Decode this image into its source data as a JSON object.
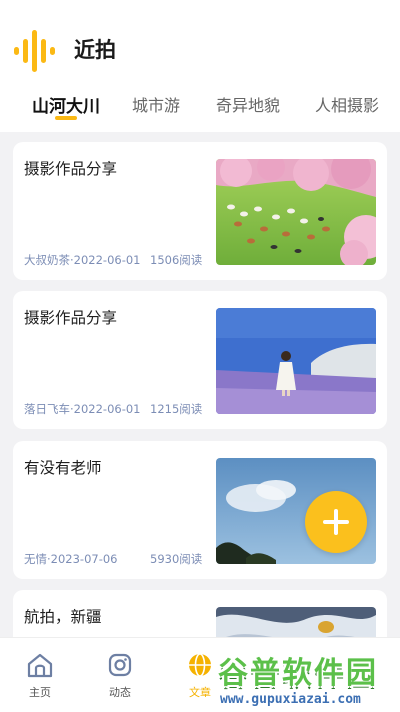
{
  "app": {
    "title": "近拍",
    "logo_icon": "sound-wave-logo-icon",
    "accent": "#fbb914"
  },
  "tabs": [
    {
      "label": "山河大川",
      "active": true
    },
    {
      "label": "城市游",
      "active": false
    },
    {
      "label": "奇异地貌",
      "active": false
    },
    {
      "label": "人相摄影",
      "active": false
    }
  ],
  "posts": [
    {
      "title": "摄影作品分享",
      "meta": "大叔奶茶·2022-06-01",
      "reads": "1506阅读",
      "image": "pink-trees-goats-meadow-photo"
    },
    {
      "title": "摄影作品分享",
      "meta": "落日飞车·2022-06-01",
      "reads": "1215阅读",
      "image": "girl-lavender-lake-photo"
    },
    {
      "title": "有没有老师",
      "meta": "无情·2023-07-06",
      "reads": "5930阅读",
      "image": "blue-sky-clouds-photo"
    },
    {
      "title": "航拍，新疆",
      "meta": "",
      "reads": "",
      "image": "aerial-snow-landscape-photo"
    }
  ],
  "fab": {
    "icon": "plus-icon"
  },
  "bottom_nav": [
    {
      "label": "主页",
      "icon": "home-icon",
      "active": false
    },
    {
      "label": "动态",
      "icon": "camera-icon",
      "active": false
    },
    {
      "label": "文章",
      "icon": "globe-icon",
      "active": true
    }
  ],
  "watermark": {
    "title": "谷普软件园",
    "url": "www.gupuxiazai.com"
  }
}
